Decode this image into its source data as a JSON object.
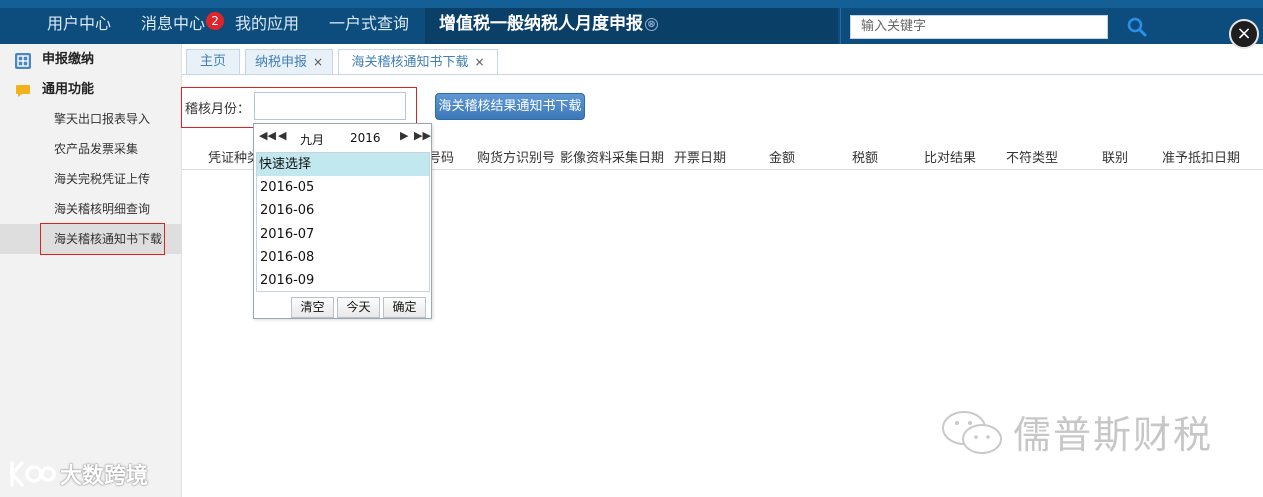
{
  "topnav": {
    "items": [
      "用户中心",
      "消息中心",
      "我的应用",
      "一户式查询"
    ],
    "message_badge": "2",
    "active_tab": "增值税一般纳税人月度申报",
    "close_icon": "⊗"
  },
  "search": {
    "placeholder": "输入关键字",
    "icon": "search-icon"
  },
  "window_close": "×",
  "sidebar": {
    "groups": [
      "申报缴纳",
      "通用功能"
    ],
    "items": [
      "擎天出口报表导入",
      "农产品发票采集",
      "海关完税凭证上传",
      "海关稽核明细查询",
      "海关稽核通知书下载"
    ],
    "active_item": "海关稽核通知书下载"
  },
  "tabs": [
    {
      "label": "主页",
      "closable": false
    },
    {
      "label": "纳税申报",
      "closable": true
    },
    {
      "label": "海关稽核通知书下载",
      "closable": true,
      "active": true
    }
  ],
  "tab_close": "×",
  "form": {
    "month_label": "稽核月份：",
    "month_value": "",
    "download_button": "海关稽核结果通知书下载"
  },
  "table": {
    "columns": [
      "凭证种类",
      "号码",
      "购货方识别号",
      "影像资料采集日期",
      "开票日期",
      "金额",
      "税额",
      "比对结果",
      "不符类型",
      "联别",
      "准予抵扣日期"
    ]
  },
  "datepicker": {
    "prev_year": "◀◀",
    "prev_month": "◀",
    "next_month": "▶",
    "next_year": "▶▶",
    "month": "九月",
    "year": "2016",
    "quick_title": "快速选择",
    "options": [
      "2016-05",
      "2016-06",
      "2016-07",
      "2016-08",
      "2016-09"
    ],
    "buttons": [
      "清空",
      "今天",
      "确定"
    ]
  },
  "watermarks": {
    "right": "儒普斯财税",
    "left": "大数跨境"
  },
  "colors": {
    "topbar": "#0c4d7e",
    "accent": "#3c77b8",
    "highlight": "#dd2222"
  }
}
